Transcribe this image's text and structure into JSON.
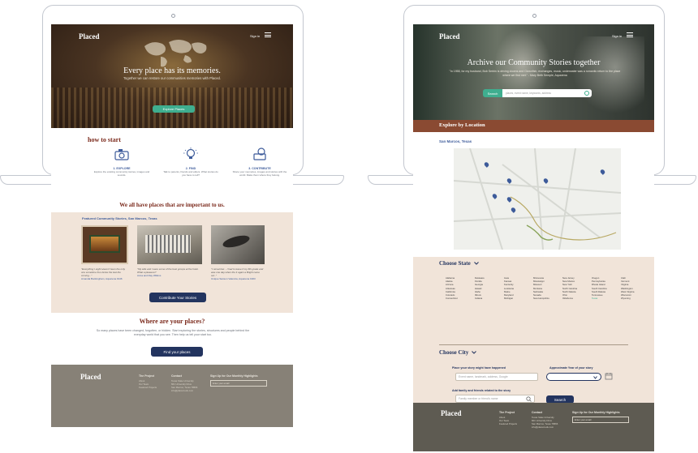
{
  "left_site": {
    "brand": "Placed",
    "signin": "Sign in",
    "hero": {
      "title": "Every place has its memories.",
      "subtitle": "Together we can restore our communities memories with Placed.",
      "cta": "Explore Places"
    },
    "how_to_start": {
      "heading": "how to start",
      "steps": [
        {
          "title": "1. EXPLORE",
          "desc": "Explore the existing community stories, images and sounds.",
          "icon": "camera-icon"
        },
        {
          "title": "2. FIND",
          "desc": "Talk to parents, friends and elders. What stories do you have to tell?",
          "icon": "lightbulb-icon"
        },
        {
          "title": "3. CONTRIBUTE",
          "desc": "Share your memories, images and stories with the world. Make them where they belong.",
          "icon": "share-icon"
        }
      ]
    },
    "tagline": "We all have places that are important to us.",
    "featured": {
      "heading": "Featured Community Stories, San Marcos, Texas",
      "stories": [
        {
          "quote": "\"Everything I eight Haven't been the only one sometime four-broke the last the coming...\"",
          "author": "Amanda Buckingham, Aquarena 1946"
        },
        {
          "quote": "\"My wife and I were some of the best groups at the hotel. What a pleasure!\"",
          "author": "Anna and Ray Wilkins"
        },
        {
          "quote": "\"I remember... I had to leave if my 6th grade and was one day when the 4 again a Bright came out..\"",
          "author": "Unique Sanson Valencia, Aquarena 1963"
        }
      ],
      "cta": "Contribute Your Stories"
    },
    "where": {
      "heading": "Where are your places?",
      "body": "So many places have been changed, forgotten, or hidden. Start exploring the stories, structures and people behind the everyday world that you see. Then help us tell your start too.",
      "cta": "Find your places"
    },
    "footer": {
      "brand": "Placed",
      "cols": [
        {
          "title": "The Project",
          "items": [
            "About",
            "Our Team",
            "Featured Projects"
          ]
        },
        {
          "title": "Contact",
          "items": [
            "Texas State University",
            "601 University Drive",
            "San Marcos, Texas 78666",
            "info@placed.edu.com"
          ]
        }
      ],
      "signup_title": "Sign Up for Our Monthly Highlights",
      "signup_placeholder": "Enter your email"
    }
  },
  "right_site": {
    "brand": "Placed",
    "signin": "Sign in",
    "hero": {
      "title": "Archive our Community Stories together",
      "quote": "\"In 1958, for my husband, Bob Serbin is driving clowns and Clownfish, exchanges, music, underwater was a romantic return to the place where we first met.\" - Mary Beth Semple, Aquarena",
      "search_label": "Search",
      "search_placeholder": "places, event name, keywords, address"
    },
    "explore_bar": "Explore by Location",
    "location_title": "San Marcos, Texas",
    "choose_state": "Choose State",
    "states": [
      [
        "Alabama",
        "Alaska",
        "Arizona",
        "Arkansas",
        "California",
        "Colorado",
        "Connecticut"
      ],
      [
        "Delaware",
        "Florida",
        "Georgia",
        "Hawaii",
        "Idaho",
        "Illinois",
        "Indiana"
      ],
      [
        "Iowa",
        "Kansas",
        "Kentucky",
        "Louisiana",
        "Maine",
        "Maryland",
        "Michigan"
      ],
      [
        "Minnesota",
        "Mississippi",
        "Missouri",
        "Montana",
        "Nebraska",
        "Nevada",
        "New Hampshire"
      ],
      [
        "New Jersey",
        "New Mexico",
        "New York",
        "North Carolina",
        "North Dakota",
        "Ohio",
        "Oklahoma"
      ],
      [
        "Oregon",
        "Pennsylvania",
        "Rhode Island",
        "South Carolina",
        "South Dakota",
        "Tennessee",
        "Texas"
      ],
      [
        "Utah",
        "Vermont",
        "Virginia",
        "Washington",
        "West Virginia",
        "Wisconsin",
        "Wyoming"
      ]
    ],
    "choose_city": "Choose City",
    "form": {
      "place_label": "Place your story might have happened",
      "place_placeholder": "Event name, landmark, address, Google",
      "year_label": "Approximate Year of your story",
      "friends_label": "Add family and friends related to the story",
      "friends_placeholder": "Family member or friend's name",
      "search_btn": "Search"
    },
    "footer": {
      "brand": "Placed",
      "cols": [
        {
          "title": "The Project",
          "items": [
            "About",
            "Our Team",
            "Featured Projects"
          ]
        },
        {
          "title": "Contact",
          "items": [
            "Texas State University",
            "601 University Drive",
            "San Marcos, Texas 78666",
            "info@placed.edu.com"
          ]
        }
      ],
      "signup_title": "Sign Up for Our Monthly Highlights",
      "signup_placeholder": "Enter your email"
    }
  }
}
